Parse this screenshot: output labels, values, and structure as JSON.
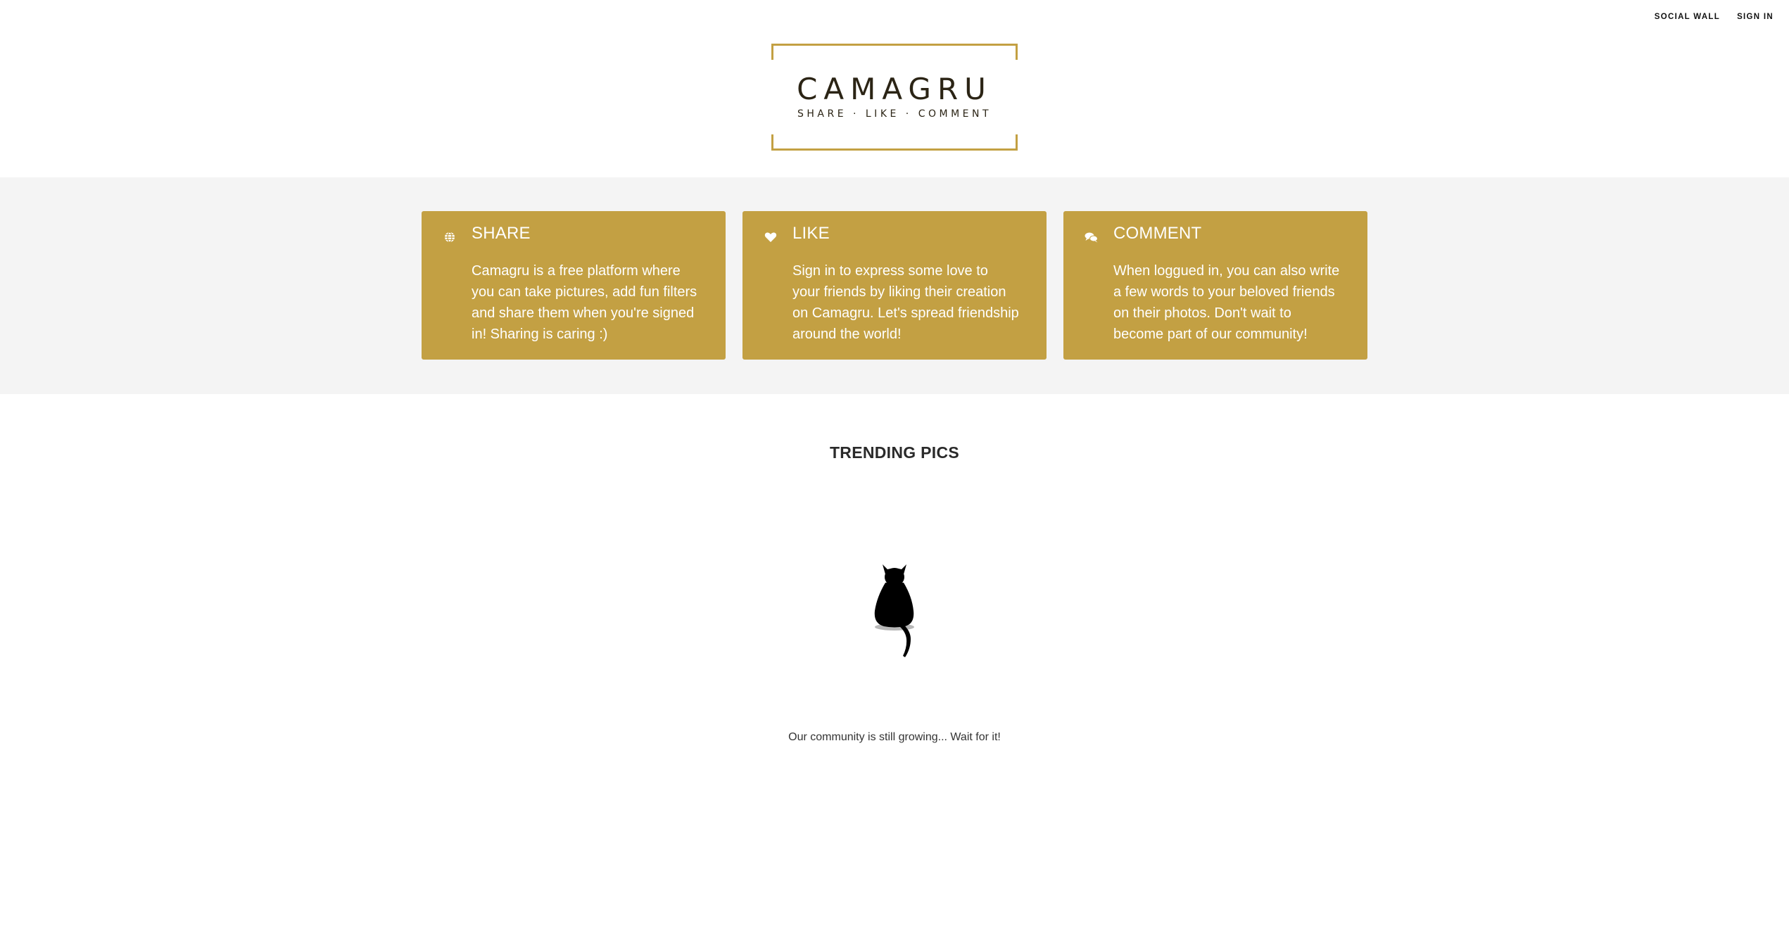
{
  "nav": {
    "social_wall": "SOCIAL WALL",
    "sign_in": "SIGN IN"
  },
  "logo": {
    "title": "CAMAGRU",
    "tagline": "SHARE · LIKE · COMMENT"
  },
  "features": [
    {
      "icon": "globe-icon",
      "title": "SHARE",
      "text": "Camagru is a free platform where you can take pictures, add fun filters and share them when you're signed in! Sharing is caring :)"
    },
    {
      "icon": "heart-icon",
      "title": "LIKE",
      "text": "Sign in to express some love to your friends by liking their creation on Camagru. Let's spread friendship around the world!"
    },
    {
      "icon": "comments-icon",
      "title": "COMMENT",
      "text": "When loggued in, you can also write a few words to your beloved friends on their photos. Don't wait to become part of our community!"
    }
  ],
  "trending": {
    "title": "TRENDING PICS",
    "empty_message": "Our community is still growing... Wait for it!",
    "empty_image": "cat-silhouette-icon"
  },
  "colors": {
    "accent": "#c3a043",
    "band_background": "#f4f4f4",
    "page_background": "#ffffff"
  }
}
